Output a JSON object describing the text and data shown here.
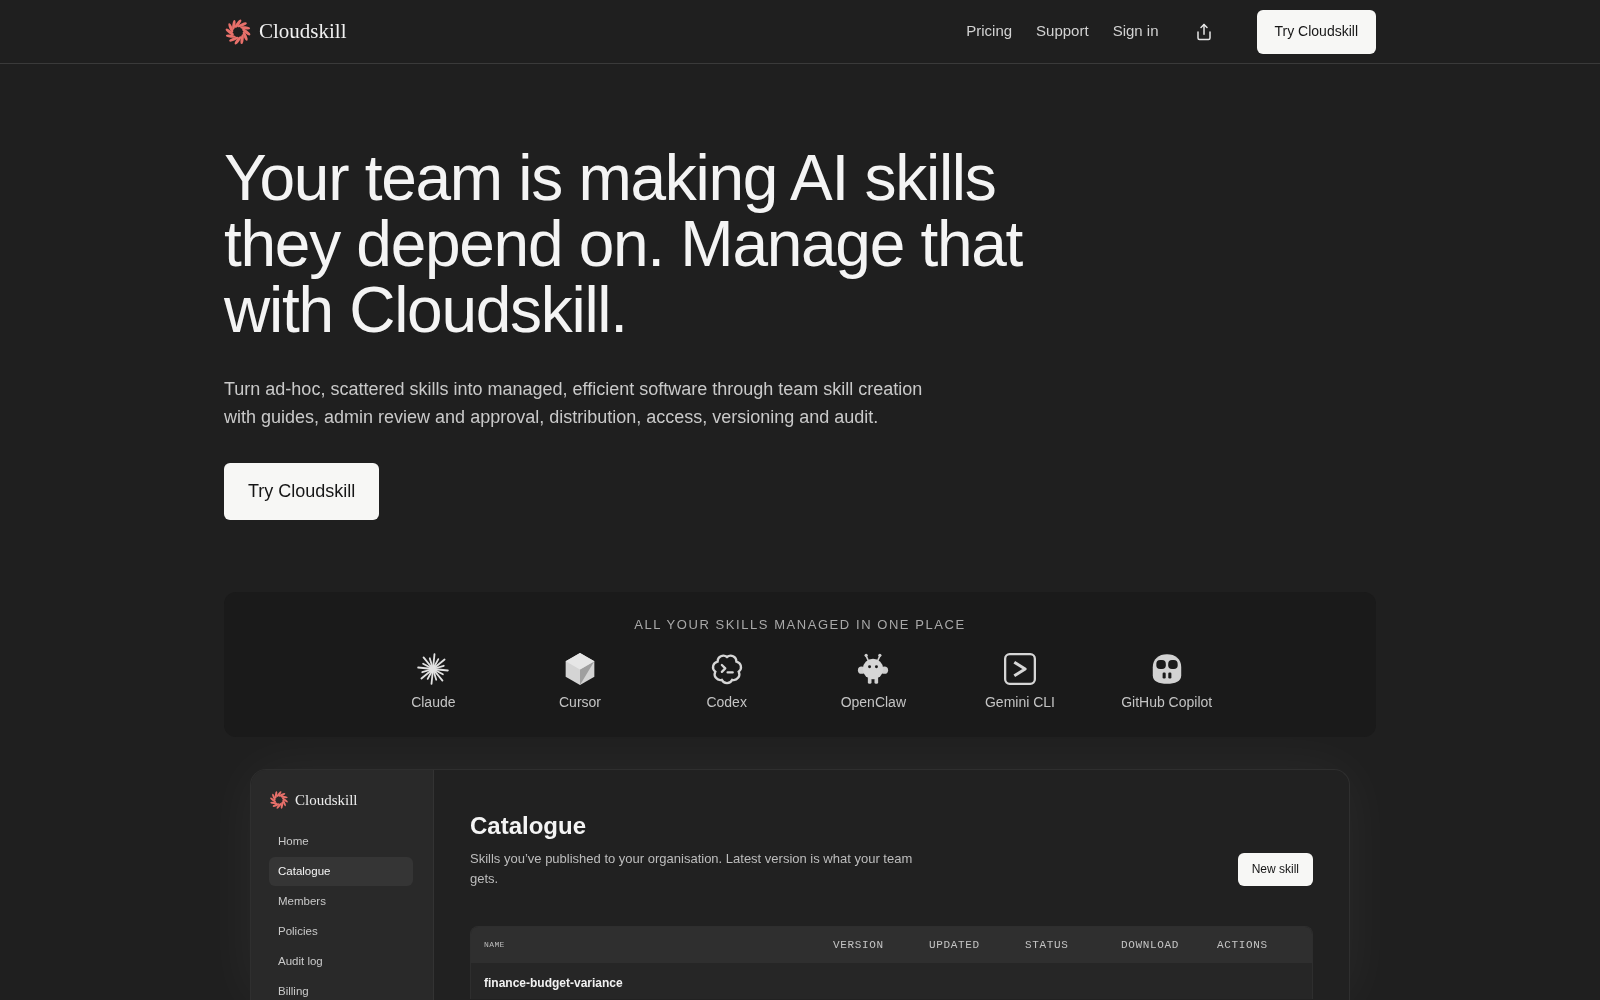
{
  "header": {
    "logo_text": "Cloudskill",
    "nav": [
      "Pricing",
      "Support",
      "Sign in"
    ],
    "cta": "Try Cloudskill"
  },
  "hero": {
    "title": "Your team is making AI skills they depend on. Manage that with Cloudskill.",
    "subtitle": "Turn ad-hoc, scattered skills into managed, efficient software through team skill creation with guides, admin review and approval, distribution, access, versioning and audit.",
    "cta": "Try Cloudskill"
  },
  "integrations": {
    "heading": "ALL YOUR SKILLS MANAGED IN ONE PLACE",
    "items": [
      "Claude",
      "Cursor",
      "Codex",
      "OpenClaw",
      "Gemini CLI",
      "GitHub Copilot"
    ]
  },
  "app_preview": {
    "sidebar": {
      "logo_text": "Cloudskill",
      "items": [
        {
          "label": "Home",
          "selected": false
        },
        {
          "label": "Catalogue",
          "selected": true
        },
        {
          "label": "Members",
          "selected": false
        },
        {
          "label": "Policies",
          "selected": false
        },
        {
          "label": "Audit log",
          "selected": false
        },
        {
          "label": "Billing",
          "selected": false
        }
      ]
    },
    "page": {
      "title": "Catalogue",
      "description": "Skills you’ve published to your organisation. Latest version is what your team gets.",
      "button": "New skill",
      "table": {
        "columns": [
          "NAME",
          "VERSION",
          "UPDATED",
          "STATUS",
          "DOWNLOAD",
          "ACTIONS"
        ],
        "rows": [
          {
            "name": "finance-budget-variance"
          }
        ]
      }
    }
  }
}
